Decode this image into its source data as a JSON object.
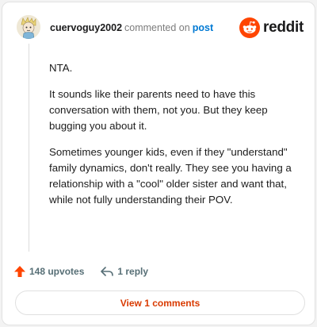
{
  "comment": {
    "username": "cuervoguy2002",
    "commented_text": "commented on",
    "post_link": "post",
    "paragraphs": [
      "NTA.",
      "It sounds like their parents need to have this conversation with them, not you. But they keep bugging you about it.",
      "Sometimes younger kids, even if they \"understand\" family dynamics, don't really. They see you having a relationship with a \"cool\" older sister and want that, while not fully understanding their POV."
    ]
  },
  "brand": {
    "wordmark": "reddit",
    "color": "#ff4500"
  },
  "actions": {
    "upvotes": "148 upvotes",
    "replies": "1 reply"
  },
  "view_button": "View 1 comments",
  "icons": [
    "avatar",
    "reddit-logo-icon",
    "upvote-arrow-icon",
    "reply-arrow-icon"
  ]
}
